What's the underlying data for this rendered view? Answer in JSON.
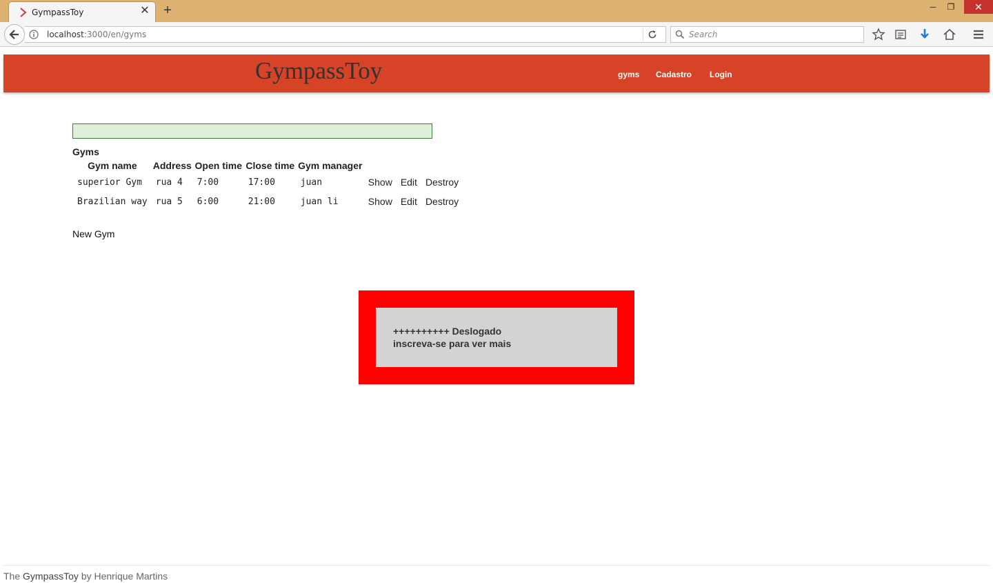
{
  "browser": {
    "tab_title": "GympassToy",
    "tab_close": "✕",
    "new_tab": "+",
    "url_host": "localhost",
    "url_path": ":3000/en/gyms",
    "search_placeholder": "Search",
    "window_controls": {
      "minimize": "─",
      "maximize": "❐",
      "close": "✕"
    },
    "icons": [
      "back-arrow-icon",
      "info-icon",
      "reload-icon",
      "search-icon",
      "bookmark-star-icon",
      "reading-list-icon",
      "download-icon",
      "home-icon",
      "menu-icon"
    ]
  },
  "header": {
    "brand": "GympassToy",
    "nav": [
      "gyms",
      "Cadastro",
      "Login"
    ],
    "color": "#d64326"
  },
  "notice": {
    "color": "#dff0d8"
  },
  "gyms": {
    "title": "Gyms",
    "columns": [
      "Gym name",
      "Address",
      "Open time",
      "Close time",
      "Gym manager"
    ],
    "rows": [
      {
        "name": "superior Gym",
        "address": "rua 4",
        "open": "7:00",
        "close": "17:00",
        "manager": "juan",
        "show": "Show",
        "edit": "Edit",
        "destroy": "Destroy"
      },
      {
        "name": "Brazilian way",
        "address": "rua 5",
        "open": "6:00",
        "close": "21:00",
        "manager": "juan li",
        "show": "Show",
        "edit": "Edit",
        "destroy": "Destroy"
      }
    ],
    "new_link": "New Gym"
  },
  "alert": {
    "line1": "++++++++++ Deslogado",
    "line2": "inscreva-se para ver mais",
    "border_color": "#ff0000",
    "background": "#d3d3d3"
  },
  "footer": {
    "prefix": "The",
    "brand": "GympassToy",
    "suffix": "by Henrique Martins"
  }
}
